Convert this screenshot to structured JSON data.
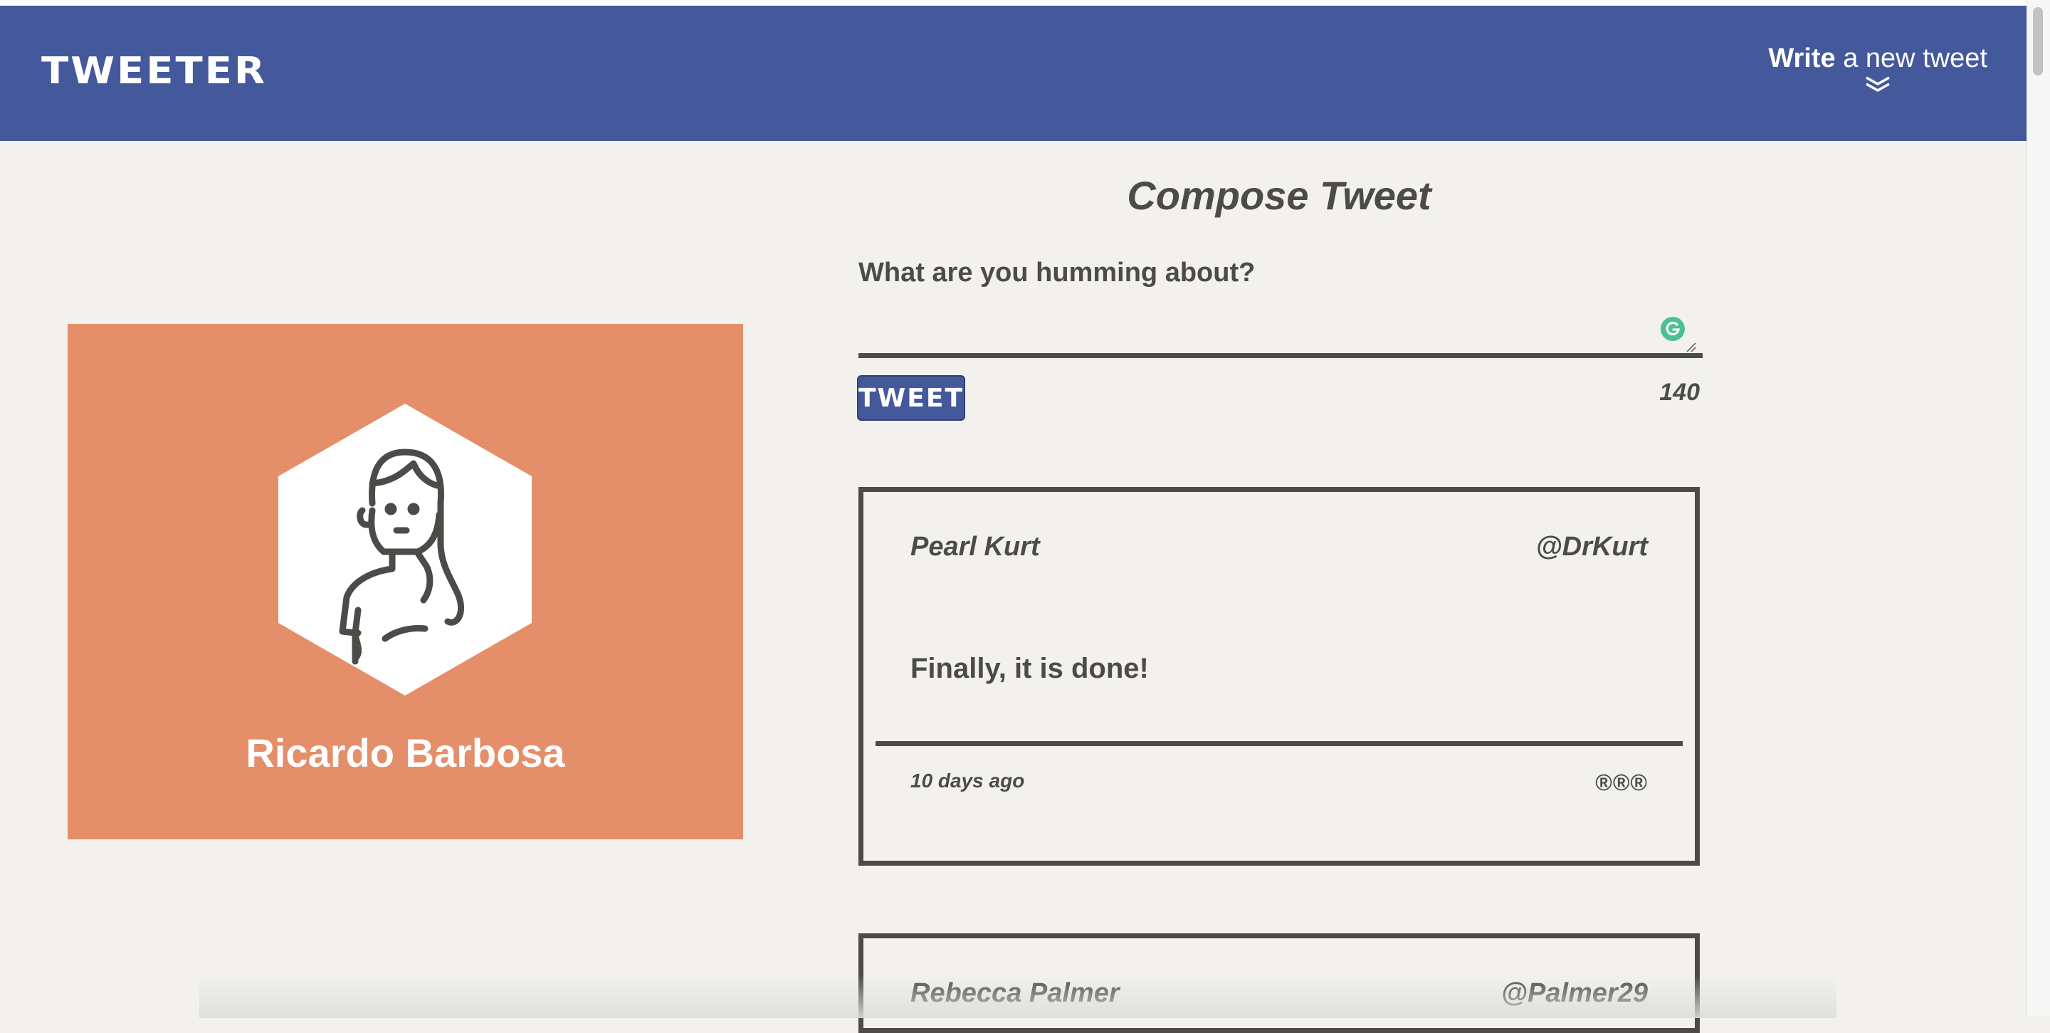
{
  "header": {
    "logo": "TWEETER",
    "write_strong": "Write",
    "write_rest": " a new tweet",
    "toggle_icon": "double-chevron-down-icon",
    "color": "#44599c"
  },
  "profile": {
    "first_name": "Ricardo",
    "last_name": " Barbosa",
    "card_color": "#e58e6a",
    "avatar_icon": "person-avatar-icon"
  },
  "compose": {
    "title": "Compose Tweet",
    "label": "What are you humming about?",
    "textarea_value": "",
    "button_label": "TWEET",
    "counter": "140"
  },
  "tweets": [
    {
      "name": "Pearl Kurt",
      "handle": "@DrKurt",
      "content": "Finally, it is done!",
      "time": "10 days ago",
      "actions": "®®®"
    },
    {
      "name": "Rebecca Palmer",
      "handle": "@Palmer29"
    }
  ]
}
